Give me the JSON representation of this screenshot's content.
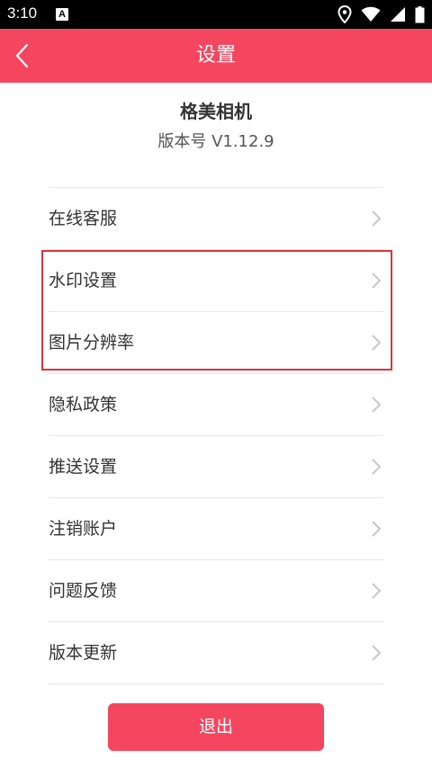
{
  "status_bar": {
    "time": "3:10",
    "notification_badge": "A"
  },
  "app_bar": {
    "title": "设置",
    "back_icon": "chevron-left-icon"
  },
  "header": {
    "app_name": "格美相机",
    "version": "版本号 V1.12.9"
  },
  "settings": {
    "items": [
      {
        "label": "在线客服"
      },
      {
        "label": "水印设置"
      },
      {
        "label": "图片分辨率"
      },
      {
        "label": "隐私政策"
      },
      {
        "label": "推送设置"
      },
      {
        "label": "注销账户"
      },
      {
        "label": "问题反馈"
      },
      {
        "label": "版本更新"
      }
    ]
  },
  "logout": {
    "label": "退出"
  },
  "colors": {
    "accent": "#f4475f",
    "highlight": "#d9353a"
  }
}
